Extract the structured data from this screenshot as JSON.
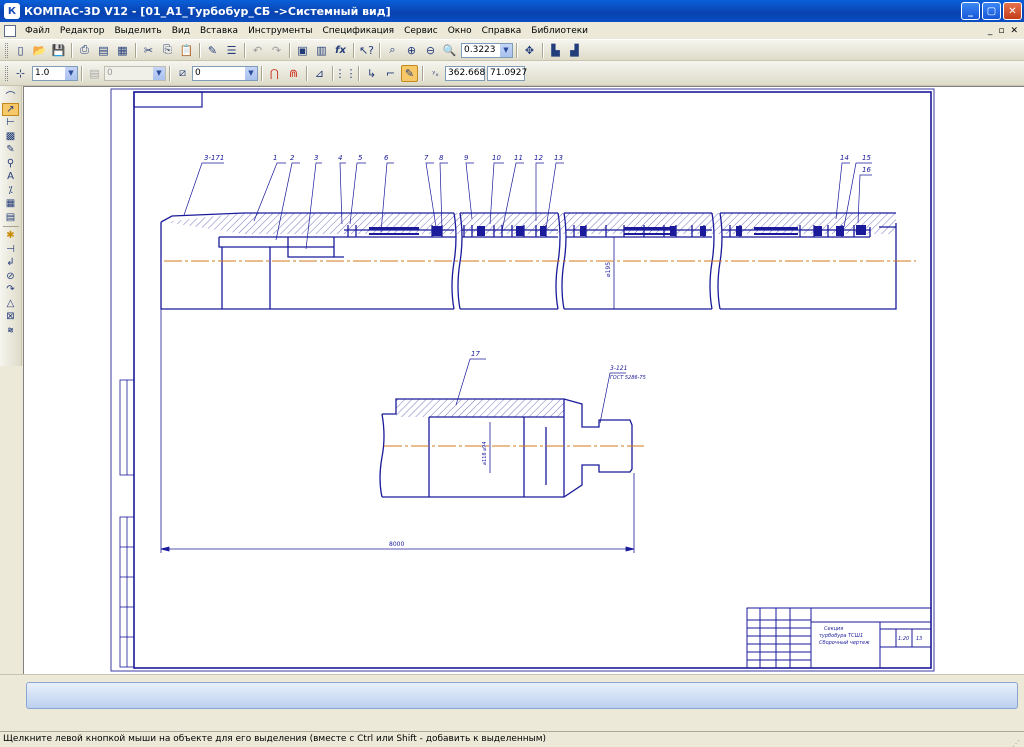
{
  "window": {
    "title": "КОМПАС-3D V12 - [01_A1_Турбобур_СБ ->Системный вид]"
  },
  "menu": {
    "items": [
      "Файл",
      "Редактор",
      "Выделить",
      "Вид",
      "Вставка",
      "Инструменты",
      "Спецификация",
      "Сервис",
      "Окно",
      "Справка",
      "Библиотеки"
    ]
  },
  "toolbar": {
    "zoom_value": "0.3223"
  },
  "params": {
    "step_value": "1.0",
    "layer_value": "0",
    "style_value": "0",
    "coord_x": "362.668",
    "coord_y": "71.0927"
  },
  "drawing": {
    "callouts": [
      "1",
      "2",
      "3",
      "4",
      "5",
      "6",
      "7",
      "8",
      "9",
      "10",
      "11",
      "12",
      "13",
      "14",
      "15",
      "16",
      "17"
    ],
    "thread_top": "3-171",
    "thread_bottom": "3-121",
    "gost_note": "ГОСТ 5286-75",
    "dim_diameter_1": "⌀195",
    "dim_diameter_2": "⌀118 ⌀94",
    "dim_length": "8000",
    "title_block": {
      "name_line1": "Секция",
      "name_line2": "турбобура ТСШ1",
      "name_line3": "Сборочный чертеж",
      "scale": "1:20",
      "sheet_count": "13"
    }
  },
  "status": {
    "hint": "Щелкните левой кнопкой мыши на объекте для его выделения (вместе с Ctrl или Shift - добавить к выделенным)"
  },
  "icons": {
    "app": "kompas-logo-icon",
    "minimize": "minimize-icon",
    "maximize": "maximize-icon",
    "close": "close-icon"
  }
}
